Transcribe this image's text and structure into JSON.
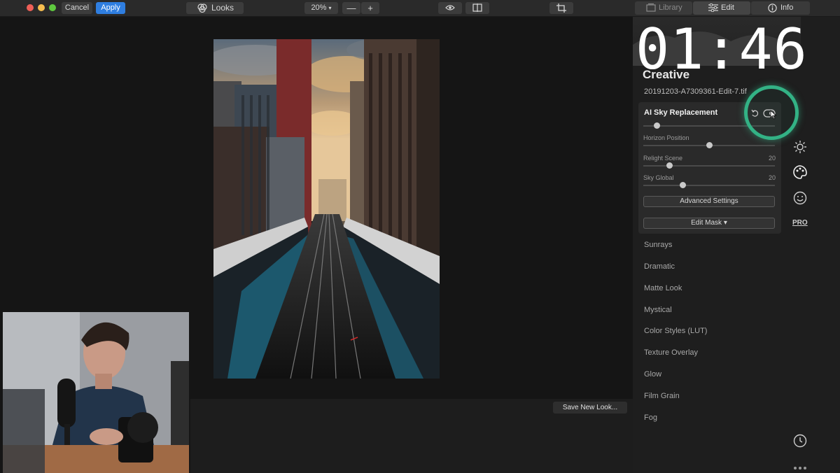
{
  "toolbar": {
    "cancel_label": "Cancel",
    "apply_label": "Apply",
    "looks_label": "Looks",
    "zoom_value": "20%",
    "zoom_out_label": "—",
    "zoom_in_label": "+",
    "tabs": [
      {
        "label": "Library",
        "icon": "library-icon"
      },
      {
        "label": "Edit",
        "icon": "sliders-icon"
      },
      {
        "label": "Info",
        "icon": "info-icon"
      }
    ]
  },
  "overlay": {
    "timer": "01:46"
  },
  "panel": {
    "section_title": "Creative",
    "filename": "20191203-A7309361-Edit-7.tif",
    "sky": {
      "title": "AI Sky Replacement",
      "sliders": [
        {
          "label": "Horizon Position",
          "value": "",
          "position": 0.5
        },
        {
          "label": "Relight Scene",
          "value": "20",
          "position": 0.2
        },
        {
          "label": "Sky Global",
          "value": "20",
          "position": 0.3
        }
      ],
      "advanced_label": "Advanced Settings",
      "edit_mask_label": "Edit Mask ▾"
    },
    "filters": [
      "Sunrays",
      "Dramatic",
      "Matte Look",
      "Mystical",
      "Color Styles (LUT)",
      "Texture Overlay",
      "Glow",
      "Film Grain",
      "Fog"
    ],
    "side_icons": [
      "sun-icon",
      "palette-icon",
      "smiley-icon",
      "pro-icon"
    ],
    "pro_label": "PRO"
  },
  "canvas": {
    "save_look_label": "Save New Look..."
  },
  "colors": {
    "accent_blue": "#2f7ee0",
    "highlight_ring": "#33b285"
  }
}
